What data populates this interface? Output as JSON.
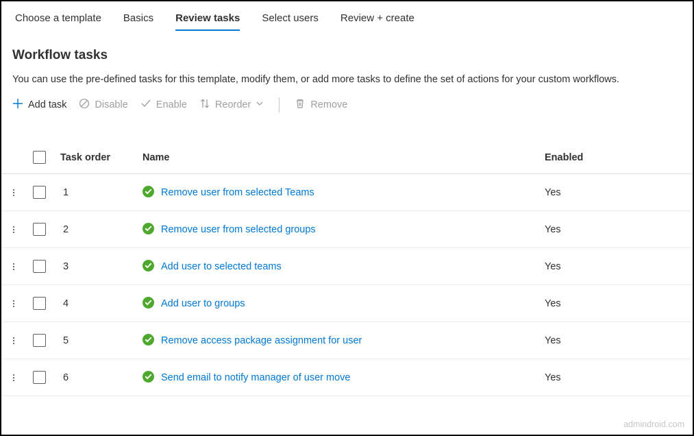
{
  "tabs": {
    "choose_template": "Choose a template",
    "basics": "Basics",
    "review_tasks": "Review tasks",
    "select_users": "Select users",
    "review_create": "Review + create"
  },
  "section_title": "Workflow tasks",
  "description": "You can use the pre-defined tasks for this template, modify them, or add more tasks to define the set of actions for your custom workflows.",
  "toolbar": {
    "add_task": "Add task",
    "disable": "Disable",
    "enable": "Enable",
    "reorder": "Reorder",
    "remove": "Remove"
  },
  "table": {
    "headers": {
      "task_order": "Task order",
      "name": "Name",
      "enabled": "Enabled"
    },
    "rows": [
      {
        "order": "1",
        "name": "Remove user from selected Teams",
        "enabled": "Yes"
      },
      {
        "order": "2",
        "name": "Remove user from selected groups",
        "enabled": "Yes"
      },
      {
        "order": "3",
        "name": "Add user to selected teams",
        "enabled": "Yes"
      },
      {
        "order": "4",
        "name": "Add user to groups",
        "enabled": "Yes"
      },
      {
        "order": "5",
        "name": "Remove access package assignment for user",
        "enabled": "Yes"
      },
      {
        "order": "6",
        "name": "Send email to notify manager of user move",
        "enabled": "Yes"
      }
    ]
  },
  "watermark": "admindroid.com"
}
